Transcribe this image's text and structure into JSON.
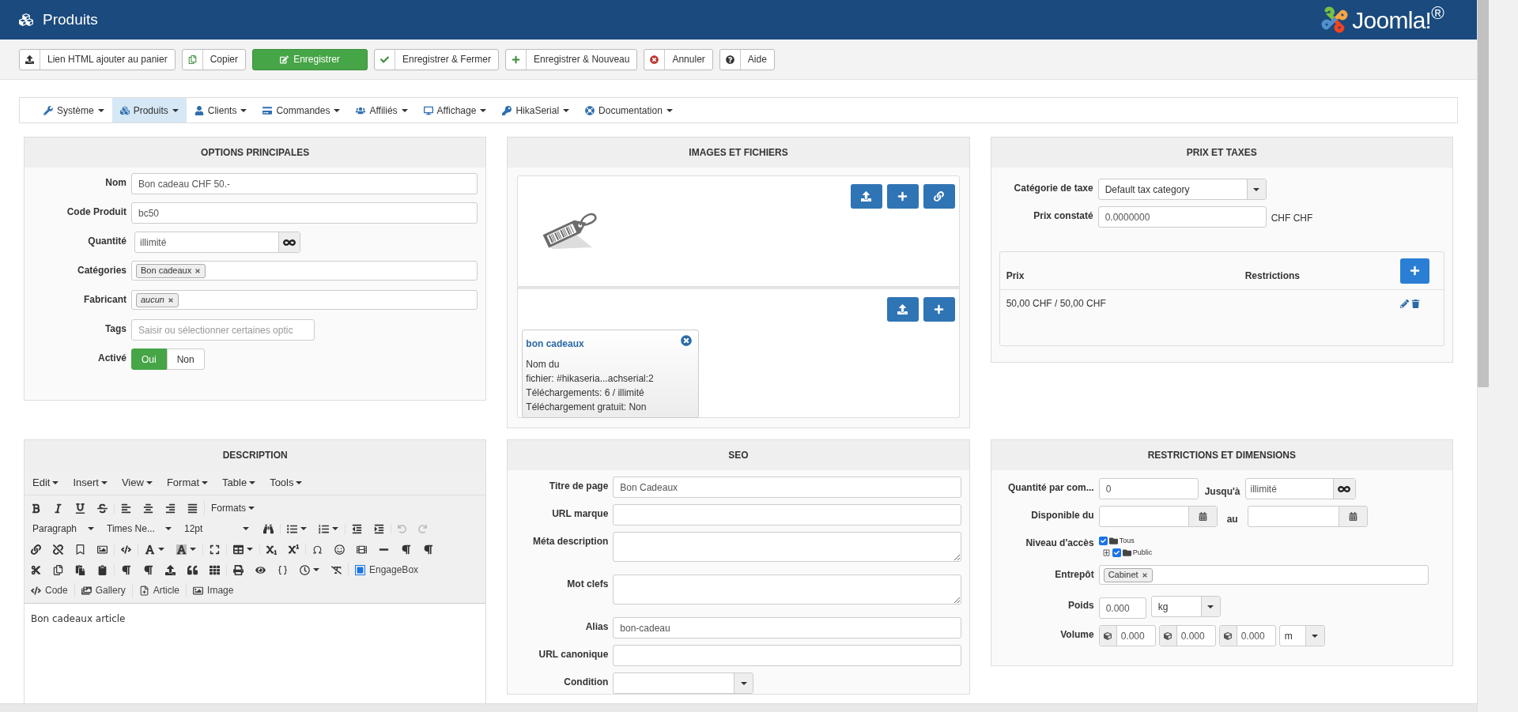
{
  "header": {
    "title": "Produits",
    "logo": "Joomla!$^{®}$"
  },
  "toolbar": [
    {
      "label": "Lien HTML ajouter au panier",
      "kind": "default"
    },
    {
      "label": "Copier",
      "kind": "default"
    },
    {
      "label": "Enregistrer",
      "kind": "primary"
    },
    {
      "label": "Enregistrer & Fermer",
      "kind": "default"
    },
    {
      "label": "Enregistrer & Nouveau",
      "kind": "default"
    },
    {
      "label": "Annuler",
      "kind": "default"
    },
    {
      "label": "Aide",
      "kind": "default"
    }
  ],
  "menu": [
    {
      "label": "Système",
      "selected": false
    },
    {
      "label": "Produits",
      "selected": true
    },
    {
      "label": "Clients",
      "selected": false
    },
    {
      "label": "Commandes",
      "selected": false
    },
    {
      "label": "Affiliés",
      "selected": false
    },
    {
      "label": "Affichage",
      "selected": false
    },
    {
      "label": "HikaSerial",
      "selected": false
    },
    {
      "label": "Documentation",
      "selected": false
    }
  ],
  "options": {
    "title": "OPTIONS PRINCIPALES",
    "fields": [
      {
        "label": "Nom",
        "kind": "text",
        "value": "Bon cadeau CHF 50.-"
      },
      {
        "label": "Code Produit",
        "kind": "text",
        "value": "bc50"
      },
      {
        "label": "Quantité",
        "kind": "unlimited",
        "value": "illimité"
      },
      {
        "label": "Catégories",
        "kind": "tags",
        "tags": [
          {
            "text": "Bon cadeaux",
            "italic": false
          }
        ]
      },
      {
        "label": "Fabricant",
        "kind": "tags",
        "tags": [
          {
            "text": "aucun",
            "italic": true
          }
        ]
      },
      {
        "label": "Tags",
        "kind": "search",
        "placeholder": "Saisir ou sélectionner certaines optic"
      },
      {
        "label": "Activé",
        "kind": "toggle",
        "options": [
          {
            "label": "Oui",
            "selected": true
          },
          {
            "label": "Non",
            "selected": false
          }
        ]
      }
    ]
  },
  "images": {
    "title": "IMAGES ET FICHIERS",
    "file": {
      "name": "bon cadeaux",
      "lines": [
        "Nom du",
        "fichier: #hikaseria...achserial:2",
        "Téléchargements: 6 / illimité",
        "Téléchargement gratuit: Non"
      ]
    }
  },
  "prices": {
    "title": "PRIX ET TAXES",
    "tax_label": "Catégorie de taxe",
    "tax_value": "Default tax category",
    "price_label": "Prix constaté",
    "price_value": "0.0000000",
    "currency": "CHF CHF",
    "columns": [
      "Prix",
      "Restrictions"
    ],
    "rows": [
      {
        "price": "50,00 CHF / 50,00 CHF"
      }
    ]
  },
  "description": {
    "title": "DESCRIPTION",
    "menu": [
      "Edit",
      "Insert",
      "View",
      "Format",
      "Table",
      "Tools"
    ],
    "formats": "Formats",
    "block": "Paragraph",
    "font": "Times Ne...",
    "size": "12pt",
    "engagebox": "EngageBox",
    "buttons": [
      "Code",
      "Gallery",
      "Article",
      "Image"
    ],
    "content": "Bon cadeaux article"
  },
  "seo": {
    "title": "SEO",
    "fields": [
      {
        "label": "Titre de page",
        "kind": "text",
        "value": "Bon Cadeaux"
      },
      {
        "label": "URL marque",
        "kind": "text"
      },
      {
        "label": "Méta description",
        "kind": "textarea"
      },
      {
        "label": "Mot clefs",
        "kind": "textarea"
      },
      {
        "label": "Alias",
        "kind": "text",
        "value": "bon-cadeau"
      },
      {
        "label": "URL canonique",
        "kind": "text"
      },
      {
        "label": "Condition",
        "kind": "select"
      }
    ]
  },
  "restrictions": {
    "title": "RESTRICTIONS ET DIMENSIONS",
    "qty_label": "Quantité par com...",
    "qty_value": "0",
    "to_label": "Jusqu'à",
    "to_value": "illimité",
    "avail_label": "Disponible du",
    "avail_to": "au",
    "access_label": "Niveau d'accès",
    "access": [
      {
        "label": "Tous",
        "checked": true,
        "children": [
          {
            "label": "Public",
            "checked": true
          }
        ]
      }
    ],
    "warehouse_label": "Entrepôt",
    "warehouse": "Cabinet",
    "weight_label": "Poids",
    "weight": "0.000",
    "weight_unit": "kg",
    "volume_label": "Volume",
    "volume": [
      "0.000",
      "0.000",
      "0.000"
    ],
    "volume_unit": "m"
  }
}
